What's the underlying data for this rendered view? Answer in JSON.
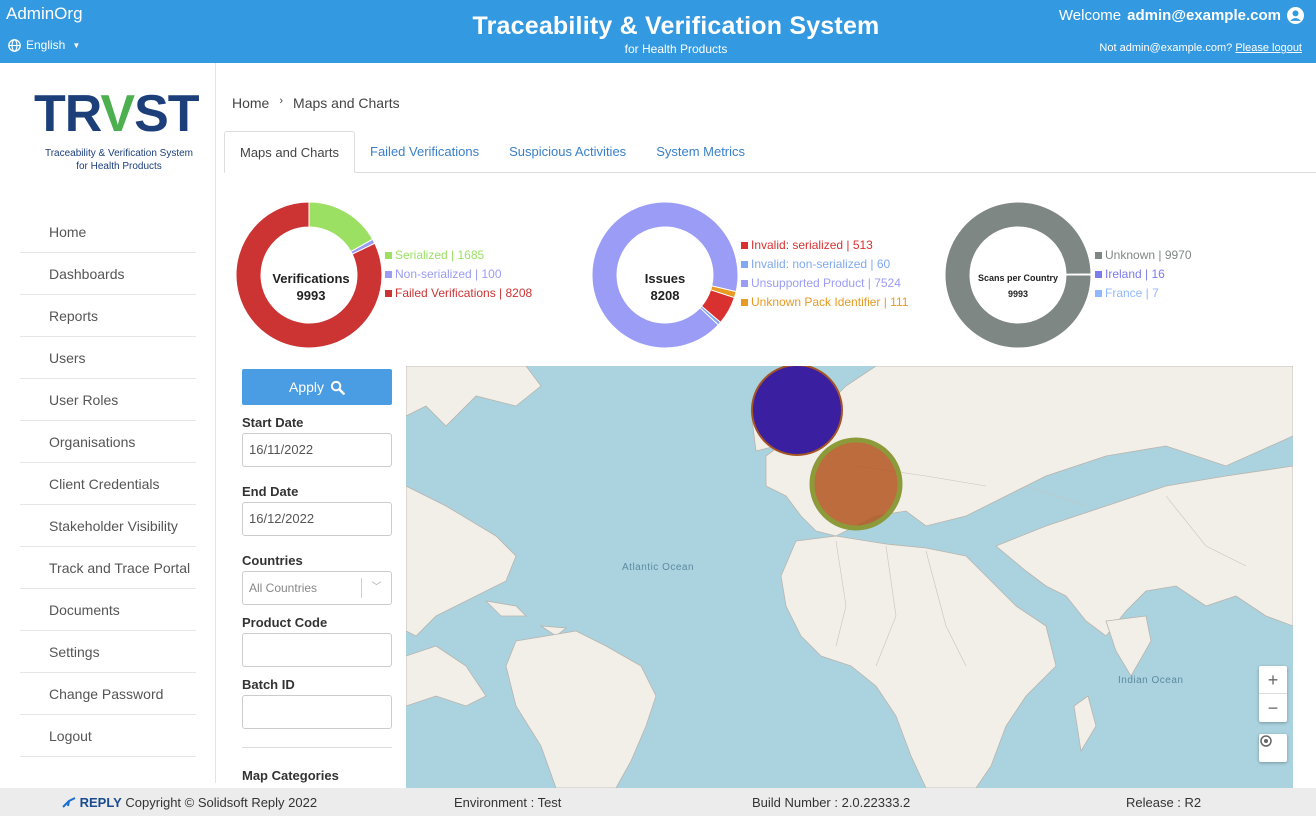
{
  "header": {
    "org": "AdminOrg",
    "language": "English",
    "title": "Traceability & Verification System",
    "subtitle": "for Health Products",
    "welcome_prefix": "Welcome",
    "user": "admin@example.com",
    "not_user": "Not admin@example.com?",
    "logout_link": "Please logout"
  },
  "logo": {
    "text_a": "TR",
    "text_v": "V",
    "text_b": "ST",
    "sub_line1": "Traceability & Verification System",
    "sub_line2": "for Health Products"
  },
  "sidebar": {
    "items": [
      {
        "label": "Home"
      },
      {
        "label": "Dashboards"
      },
      {
        "label": "Reports"
      },
      {
        "label": "Users"
      },
      {
        "label": "User Roles"
      },
      {
        "label": "Organisations"
      },
      {
        "label": "Client Credentials"
      },
      {
        "label": "Stakeholder Visibility"
      },
      {
        "label": "Track and Trace Portal"
      },
      {
        "label": "Documents"
      },
      {
        "label": "Settings"
      },
      {
        "label": "Change Password"
      },
      {
        "label": "Logout"
      }
    ]
  },
  "breadcrumb": {
    "home": "Home",
    "sep": "›",
    "current": "Maps and Charts"
  },
  "tabs": [
    {
      "label": "Maps and Charts",
      "active": true
    },
    {
      "label": "Failed Verifications"
    },
    {
      "label": "Suspicious Activities"
    },
    {
      "label": "System Metrics"
    }
  ],
  "chart_data": [
    {
      "type": "pie",
      "title": "Verifications",
      "total": "9993",
      "slices": [
        {
          "label": "Serialized",
          "value": 1685,
          "color": "#9be063",
          "display": "Serialized | 1685"
        },
        {
          "label": "Non-serialized",
          "value": 100,
          "color": "#9a9cf5",
          "display": "Non-serialized | 100"
        },
        {
          "label": "Failed Verifications",
          "value": 8208,
          "color": "#cc3333",
          "display": "Failed Verifications | 8208"
        }
      ]
    },
    {
      "type": "pie",
      "title": "Issues",
      "total": "8208",
      "slices": [
        {
          "label": "Invalid: serialized",
          "value": 513,
          "color": "#d93030",
          "display": "Invalid: serialized | 513"
        },
        {
          "label": "Invalid: non-serialized",
          "value": 60,
          "color": "#7fa8f0",
          "display": "Invalid: non-serialized | 60"
        },
        {
          "label": "Unsupported Product",
          "value": 7524,
          "color": "#9a9cf5",
          "display": "Unsupported Product | 7524"
        },
        {
          "label": "Unknown Pack Identifier",
          "value": 111,
          "color": "#e89a22",
          "display": "Unknown Pack Identifier | 111"
        }
      ]
    },
    {
      "type": "pie",
      "title": "Scans per Country",
      "total": "9993",
      "slices": [
        {
          "label": "Unknown",
          "value": 9970,
          "color": "#7f8784",
          "display": "Unknown | 9970"
        },
        {
          "label": "Ireland",
          "value": 16,
          "color": "#7b7cee",
          "display": "Ireland | 16"
        },
        {
          "label": "France",
          "value": 7,
          "color": "#8fb8ff",
          "display": "France | 7"
        }
      ]
    }
  ],
  "filters": {
    "apply_label": "Apply",
    "start_label": "Start Date",
    "start_value": "16/11/2022",
    "end_label": "End Date",
    "end_value": "16/12/2022",
    "countries_label": "Countries",
    "countries_value": "All Countries",
    "product_label": "Product Code",
    "product_value": "",
    "batch_label": "Batch ID",
    "batch_value": "",
    "map_categories_label": "Map Categories"
  },
  "map": {
    "ocean_atlantic": "Atlantic Ocean",
    "ocean_indian": "Indian Ocean",
    "zoom_in": "+",
    "zoom_out": "−",
    "compass": "⬤",
    "bubble_colors": [
      "#3a1fa0",
      "#b3551e"
    ]
  },
  "footer": {
    "brand": "REPLY",
    "copyright": "Copyright © Solidsoft Reply 2022",
    "environment": "Environment : Test",
    "build": "Build Number : 2.0.22333.2",
    "release": "Release : R2"
  }
}
